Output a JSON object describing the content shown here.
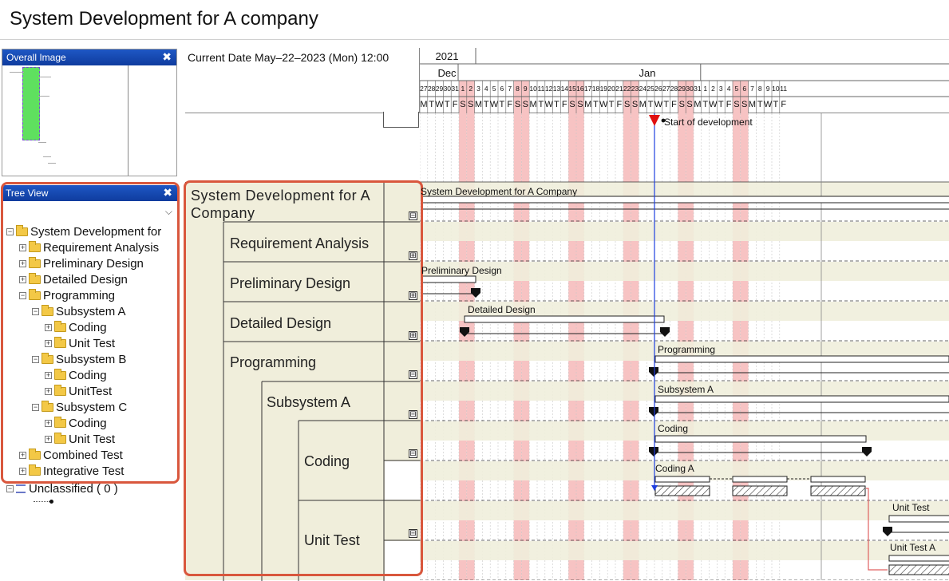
{
  "window": {
    "title": "System Development for A company"
  },
  "overall_panel": {
    "title": "Overall Image",
    "close": "✖"
  },
  "tree_panel": {
    "title": "Tree View",
    "close": "✖",
    "dropdown": "⌵",
    "items": [
      {
        "label": "System Development for",
        "depth": 0,
        "pm": "⊟"
      },
      {
        "label": "Requirement Analysis",
        "depth": 1,
        "pm": "⊞"
      },
      {
        "label": "Preliminary Design",
        "depth": 1,
        "pm": "⊞"
      },
      {
        "label": "Detailed Design",
        "depth": 1,
        "pm": "⊞"
      },
      {
        "label": "Programming",
        "depth": 1,
        "pm": "⊟"
      },
      {
        "label": "Subsystem A",
        "depth": 2,
        "pm": "⊟"
      },
      {
        "label": "Coding",
        "depth": 3,
        "pm": "⊞"
      },
      {
        "label": "Unit Test",
        "depth": 3,
        "pm": "⊞"
      },
      {
        "label": "Subsystem B",
        "depth": 2,
        "pm": "⊟"
      },
      {
        "label": "Coding",
        "depth": 3,
        "pm": "⊞"
      },
      {
        "label": "UnitTest",
        "depth": 3,
        "pm": "⊞"
      },
      {
        "label": "Subsystem C",
        "depth": 2,
        "pm": "⊟"
      },
      {
        "label": "Coding",
        "depth": 3,
        "pm": "⊞"
      },
      {
        "label": "Unit Test",
        "depth": 3,
        "pm": "⊞"
      },
      {
        "label": "Combined Test",
        "depth": 1,
        "pm": "⊞"
      },
      {
        "label": "Integrative Test",
        "depth": 1,
        "pm": "⊞"
      }
    ],
    "unclassified": "Unclassified ( 0 )"
  },
  "header": {
    "current_date": "Current Date May–22–2023 (Mon) 12:00",
    "year": "2021",
    "months": [
      "Dec",
      "Jan"
    ],
    "days": [
      "27",
      "28",
      "29",
      "30",
      "31",
      "1",
      "2",
      "3",
      "4",
      "5",
      "6",
      "7",
      "8",
      "9",
      "10",
      "11",
      "12",
      "13",
      "14",
      "15",
      "16",
      "17",
      "18",
      "19",
      "20",
      "21",
      "22",
      "23",
      "24",
      "25",
      "26",
      "27",
      "28",
      "29",
      "30",
      "31",
      "1",
      "2",
      "3",
      "4",
      "5",
      "6",
      "7",
      "8",
      "9",
      "10",
      "11"
    ],
    "weekdays": [
      "M",
      "T",
      "W",
      "T",
      "F",
      "S",
      "S",
      "M",
      "T",
      "W",
      "T",
      "F",
      "S",
      "S",
      "M",
      "T",
      "W",
      "T",
      "F",
      "S",
      "S",
      "M",
      "T",
      "W",
      "T",
      "F",
      "S",
      "S",
      "M",
      "T",
      "W",
      "T",
      "F",
      "S",
      "S",
      "M",
      "T",
      "W",
      "T",
      "F",
      "S",
      "S",
      "M",
      "T",
      "W",
      "T",
      "F"
    ]
  },
  "tasks": [
    {
      "label": "System Development for A Company",
      "level": 0,
      "expander": "⊟"
    },
    {
      "label": "Requirement Analysis",
      "level": 1,
      "expander": "⊞"
    },
    {
      "label": "Preliminary Design",
      "level": 1,
      "expander": "⊞"
    },
    {
      "label": "Detailed Design",
      "level": 1,
      "expander": "⊞"
    },
    {
      "label": "Programming",
      "level": 1,
      "expander": "⊟"
    },
    {
      "label": "Subsystem A",
      "level": 2,
      "expander": "⊟"
    },
    {
      "label": "Coding",
      "level": 3,
      "expander": "⊟"
    },
    {
      "label": "Unit Test",
      "level": 3,
      "expander": "⊟"
    }
  ],
  "chart": {
    "milestone_label": "Start of development",
    "bar_labels": [
      "System Development for A Company",
      "Preliminary Design",
      "Detailed Design",
      "Programming",
      "Subsystem A",
      "Coding",
      "Coding A",
      "Unit Test",
      "Unit Test A"
    ],
    "colors": {
      "weekend": "#f7c3c3",
      "today_line": "#1f3fe0",
      "milestone": "#e01010",
      "panel_blue": "#1e57c5",
      "highlight": "#d9573d",
      "tasks_bg": "#f0eedb"
    }
  }
}
